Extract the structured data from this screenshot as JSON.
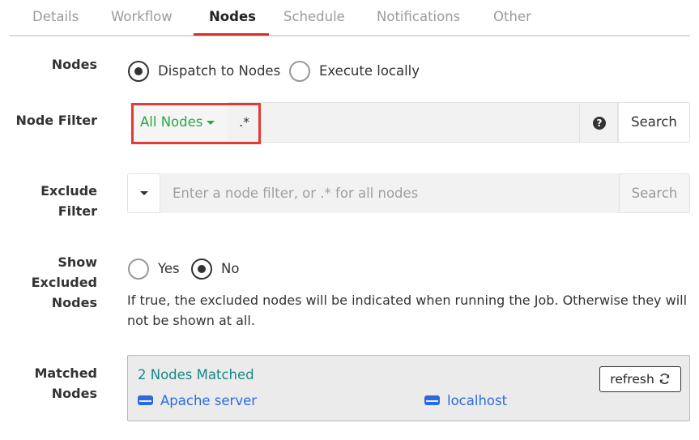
{
  "tabs": [
    {
      "label": "Details"
    },
    {
      "label": "Workflow"
    },
    {
      "label": "Nodes",
      "active": true
    },
    {
      "label": "Schedule"
    },
    {
      "label": "Notifications"
    },
    {
      "label": "Other"
    }
  ],
  "nodes_section": {
    "label": "Nodes",
    "options": [
      {
        "label": "Dispatch to Nodes",
        "selected": true
      },
      {
        "label": "Execute locally",
        "selected": false
      }
    ]
  },
  "node_filter": {
    "label": "Node Filter",
    "dropdown_label": "All Nodes",
    "value": ".*",
    "help_icon": "question-circle-icon",
    "search_label": "Search"
  },
  "exclude_filter": {
    "label_line1": "Exclude",
    "label_line2": "Filter",
    "placeholder": "Enter a node filter, or .* for all nodes",
    "search_label": "Search"
  },
  "show_excluded": {
    "label_line1": "Show",
    "label_line2": "Excluded",
    "label_line3": "Nodes",
    "options": [
      {
        "label": "Yes",
        "selected": false
      },
      {
        "label": "No",
        "selected": true
      }
    ],
    "help_text": "If true, the excluded nodes will be indicated when running the Job. Otherwise they will not be shown at all."
  },
  "matched_nodes": {
    "label_line1": "Matched",
    "label_line2": "Nodes",
    "count_text": "2 Nodes Matched",
    "refresh_label": "refresh",
    "nodes": [
      {
        "name": "Apache server",
        "icon": "server-icon"
      },
      {
        "name": "localhost",
        "icon": "server-icon"
      }
    ]
  },
  "colors": {
    "active_tab_underline": "#e02a2a",
    "highlight_box": "#e53935",
    "filter_green": "#28a745",
    "matched_teal": "#17878a",
    "node_link_blue": "#2d6ae0"
  }
}
